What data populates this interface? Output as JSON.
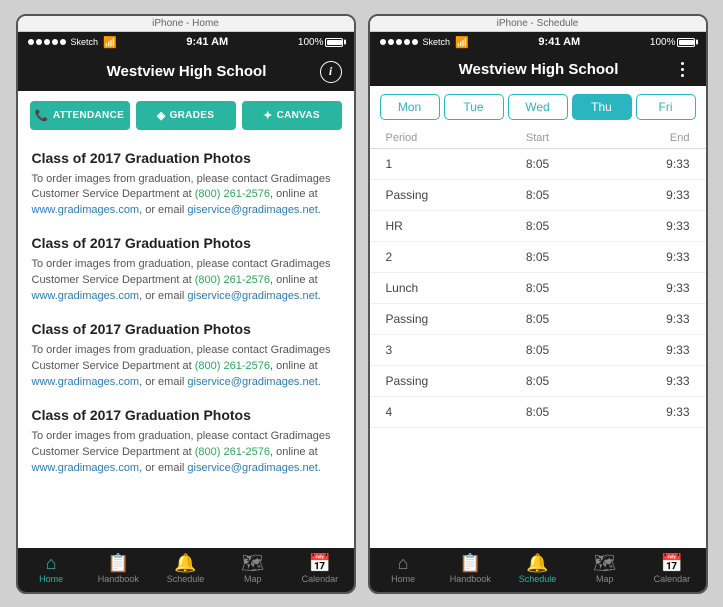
{
  "phone1": {
    "label": "iPhone - Home",
    "status": {
      "signal": "●●●●●",
      "network": "Sketch",
      "wifi": true,
      "time": "9:41 AM",
      "battery": "100%"
    },
    "header": {
      "title": "Westview High School"
    },
    "buttons": [
      {
        "id": "attendance",
        "label": "ATTENDANCE",
        "icon": "📞"
      },
      {
        "id": "grades",
        "label": "GRADES",
        "icon": "◈"
      },
      {
        "id": "canvas",
        "label": "CANVAS",
        "icon": "✦"
      }
    ],
    "news": [
      {
        "title": "Class of 2017 Graduation Photos",
        "body": "To order images from graduation, please contact Gradimages Customer Service Department at ",
        "phone": "(800) 261-2576",
        "mid1": ", online at ",
        "url": "www.gradimages.com",
        "mid2": ", or email ",
        "email": "giservice@gradimages.net",
        "end": "."
      },
      {
        "title": "Class of 2017 Graduation Photos",
        "body": "To order images from graduation, please contact Gradimages Customer Service Department at ",
        "phone": "(800) 261-2576",
        "mid1": ", online at ",
        "url": "www.gradimages.com",
        "mid2": ", or email ",
        "email": "giservice@gradimages.net",
        "end": "."
      },
      {
        "title": "Class of 2017 Graduation Photos",
        "body": "To order images from graduation, please contact Gradimages Customer Service Department at ",
        "phone": "(800) 261-2576",
        "mid1": ", online at ",
        "url": "www.gradimages.com",
        "mid2": ", or email ",
        "email": "giservice@gradimages.net",
        "end": "."
      },
      {
        "title": "Class of 2017 Graduation Photos",
        "body": "To order images from graduation, please contact Gradimages Customer Service Department at ",
        "phone": "(800) 261-2576",
        "mid1": ", online at ",
        "url": "www.gradimages.com",
        "mid2": ", or email ",
        "email": "giservice@gradimages.net",
        "end": "."
      }
    ],
    "nav": [
      {
        "id": "home",
        "label": "Home",
        "icon": "⌂",
        "active": true
      },
      {
        "id": "handbook",
        "label": "Handbook",
        "icon": "📋",
        "active": false
      },
      {
        "id": "schedule",
        "label": "Schedule",
        "icon": "🔔",
        "active": false
      },
      {
        "id": "map",
        "label": "Map",
        "icon": "🗺",
        "active": false
      },
      {
        "id": "calendar",
        "label": "Calendar",
        "icon": "📅",
        "active": false
      }
    ]
  },
  "phone2": {
    "label": "iPhone - Schedule",
    "status": {
      "time": "9:41 AM",
      "battery": "100%"
    },
    "header": {
      "title": "Westview High School"
    },
    "days": [
      {
        "id": "mon",
        "label": "Mon",
        "active": false
      },
      {
        "id": "tue",
        "label": "Tue",
        "active": false
      },
      {
        "id": "wed",
        "label": "Wed",
        "active": false
      },
      {
        "id": "thu",
        "label": "Thu",
        "active": true
      },
      {
        "id": "fri",
        "label": "Fri",
        "active": false
      }
    ],
    "schedule_header": {
      "period": "Period",
      "start": "Start",
      "end": "End"
    },
    "schedule_rows": [
      {
        "period": "1",
        "start": "8:05",
        "end": "9:33"
      },
      {
        "period": "Passing",
        "start": "8:05",
        "end": "9:33"
      },
      {
        "period": "HR",
        "start": "8:05",
        "end": "9:33"
      },
      {
        "period": "2",
        "start": "8:05",
        "end": "9:33"
      },
      {
        "period": "Lunch",
        "start": "8:05",
        "end": "9:33"
      },
      {
        "period": "Passing",
        "start": "8:05",
        "end": "9:33"
      },
      {
        "period": "3",
        "start": "8:05",
        "end": "9:33"
      },
      {
        "period": "Passing",
        "start": "8:05",
        "end": "9:33"
      },
      {
        "period": "4",
        "start": "8:05",
        "end": "9:33"
      }
    ],
    "nav": [
      {
        "id": "home",
        "label": "Home",
        "icon": "⌂",
        "active": false
      },
      {
        "id": "handbook",
        "label": "Handbook",
        "icon": "📋",
        "active": false
      },
      {
        "id": "schedule",
        "label": "Schedule",
        "icon": "🔔",
        "active": true
      },
      {
        "id": "map",
        "label": "Map",
        "icon": "🗺",
        "active": false
      },
      {
        "id": "calendar",
        "label": "Calendar",
        "icon": "📅",
        "active": false
      }
    ]
  }
}
